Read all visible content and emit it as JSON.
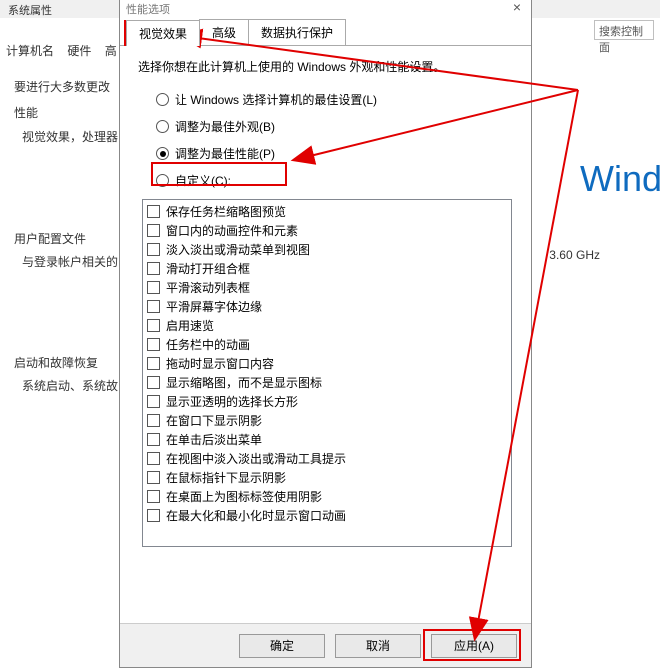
{
  "bg": {
    "topleft": "系统属性",
    "search_placeholder": "搜索控制面",
    "tabs": [
      "计算机名",
      "硬件",
      "高"
    ],
    "sec1_title": "要进行大多数更改",
    "perf_group": "性能",
    "perf_desc": "视觉效果，处理器",
    "user_group": "用户配置文件",
    "user_desc": "与登录帐户相关的",
    "startup_group": "启动和故障恢复",
    "startup_desc": "系统启动、系统故",
    "wind": "Wind",
    "ghz": "3.60 GHz"
  },
  "dialog": {
    "title": "性能选项",
    "tabs": {
      "visual": "视觉效果",
      "advanced": "高级",
      "dep": "数据执行保护"
    },
    "desc": "选择你想在此计算机上使用的 Windows 外观和性能设置。",
    "radios": {
      "r1": "让 Windows 选择计算机的最佳设置(L)",
      "r2": "调整为最佳外观(B)",
      "r3": "调整为最佳性能(P)",
      "r4": "自定义(C):"
    },
    "checks": [
      "保存任务栏缩略图预览",
      "窗口内的动画控件和元素",
      "淡入淡出或滑动菜单到视图",
      "滑动打开组合框",
      "平滑滚动列表框",
      "平滑屏幕字体边缘",
      "启用速览",
      "任务栏中的动画",
      "拖动时显示窗口内容",
      "显示缩略图，而不是显示图标",
      "显示亚透明的选择长方形",
      "在窗口下显示阴影",
      "在单击后淡出菜单",
      "在视图中淡入淡出或滑动工具提示",
      "在鼠标指针下显示阴影",
      "在桌面上为图标标签使用阴影",
      "在最大化和最小化时显示窗口动画"
    ],
    "buttons": {
      "ok": "确定",
      "cancel": "取消",
      "apply": "应用(A)"
    }
  }
}
